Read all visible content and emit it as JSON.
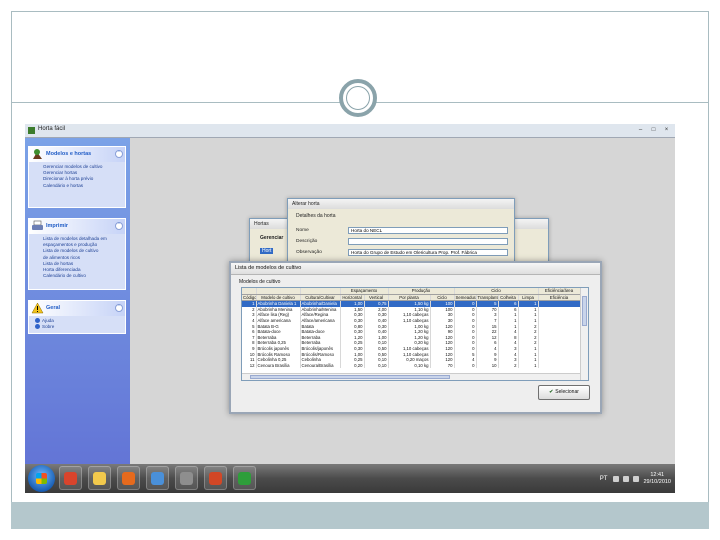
{
  "window": {
    "title": "Horta fácil"
  },
  "taskpane": {
    "groups": [
      {
        "title": "Modelos e hortas",
        "items": [
          "Gerenciar modelos de cultivo",
          "Gerenciar hortas",
          "Direcionar à horta prévio",
          "Calendário e hortas"
        ]
      },
      {
        "title": "Imprimir",
        "items": [
          "Lista de modelos detalhada em",
          "espaçamentos e produção",
          "Lista de modelos de cultivo",
          "de alimentos ricos",
          "Lista de hortas",
          "Horta diferenciada",
          "Calendário de cultivo"
        ]
      },
      {
        "title": "Geral",
        "items": [
          "Ajuda",
          "Sobre"
        ]
      }
    ]
  },
  "back_dialog": {
    "title": "Hortas",
    "tab_label": "Gerenciar",
    "tab2_label": "Hort"
  },
  "edit_dialog": {
    "title": "Alterar horta",
    "tab": "Detalhes da horta",
    "fields": [
      {
        "label": "Nome",
        "value": "Horta do NECL"
      },
      {
        "label": "Descrição",
        "value": ""
      },
      {
        "label": "Observação",
        "value": "Horta do Grupo de Estudo em Olericultura Prop. Prof. Fábrica"
      }
    ]
  },
  "list_window": {
    "title": "Lista de modelos de cultivo",
    "group_label": "Modelos de cultivo",
    "headers": [
      "Código",
      "Modelo de cultivo",
      "Cultura/Cultivar",
      "Horizontal",
      "Vertical",
      "Por planta",
      "Ciclo",
      "Semeadura",
      "Transplante",
      "Colheita",
      "Limpa",
      "Eficiência"
    ],
    "header_groups": {
      "espacamento": "Espaçamento",
      "producao": "Produção",
      "ciclo": "Ciclo",
      "eficiencia": "Eficiência/área"
    },
    "rows": [
      [
        "1",
        "Abobrinha Daniela 1",
        "Abobrinha/Daniela",
        "1,00",
        "0,75",
        "1,50 kg",
        "100",
        "0",
        "5",
        "6",
        "1"
      ],
      [
        "2",
        "Abobrinha Menina",
        "Abobrinha/Menina",
        "1,50",
        "2,00",
        "1,10 kg",
        "100",
        "0",
        "70",
        "6",
        "1"
      ],
      [
        "3",
        "Alface lisa (Reg)",
        "Alface/Regina",
        "0,30",
        "0,30",
        "1,10 cabeças",
        "30",
        "0",
        "3",
        "1",
        "1"
      ],
      [
        "4",
        "Alface americana",
        "Alface/americana",
        "0,30",
        "0,40",
        "1,10 cabeças",
        "30",
        "0",
        "7",
        "1",
        "1"
      ],
      [
        "5",
        "Batata B-G",
        "Batata",
        "0,80",
        "0,30",
        "1,00 kg",
        "120",
        "0",
        "15",
        "1",
        "2"
      ],
      [
        "6",
        "Batata-doce",
        "Batata-doce",
        "0,30",
        "0,40",
        "1,20 kg",
        "90",
        "0",
        "22",
        "4",
        "2"
      ],
      [
        "7",
        "Beterraba",
        "Beterraba",
        "1,20",
        "1,00",
        "1,20 kg",
        "120",
        "0",
        "12",
        "8",
        "2"
      ],
      [
        "8",
        "Beterraba 0,25",
        "Beterraba",
        "0,25",
        "0,10",
        "0,20 kg",
        "120",
        "0",
        "6",
        "4",
        "2"
      ],
      [
        "9",
        "Brócolis japonês",
        "Brócolis/japonês",
        "0,30",
        "0,50",
        "1,10 cabeças",
        "120",
        "0",
        "4",
        "3",
        "1"
      ],
      [
        "10",
        "Brócolis Ramoso",
        "Brócolis/Ramoso",
        "1,00",
        "0,50",
        "1,10 cabeças",
        "120",
        "5",
        "9",
        "4",
        "1"
      ],
      [
        "11",
        "Cebolinha 0,25",
        "Cebolinha",
        "0,25",
        "0,10",
        "0,20 maços",
        "120",
        "4",
        "9",
        "3",
        "1"
      ],
      [
        "12",
        "Cenoura Brasília",
        "Cenoura/Brasília",
        "0,20",
        "0,10",
        "0,10 kg",
        "70",
        "0",
        "10",
        "2",
        "1"
      ]
    ],
    "select_label": "Selecionar"
  },
  "taskbar": {
    "lang": "PT",
    "time": "12:41",
    "date": "29/10/2010",
    "apps": [
      {
        "name": "chrome",
        "color": "#d9442c"
      },
      {
        "name": "folder",
        "color": "#f2c94c"
      },
      {
        "name": "firefox",
        "color": "#e66a1d"
      },
      {
        "name": "media",
        "color": "#4a90d9"
      },
      {
        "name": "tools",
        "color": "#8e8e8e"
      },
      {
        "name": "presentation",
        "color": "#d24726"
      },
      {
        "name": "horta-app",
        "color": "#2e9e3a"
      }
    ]
  }
}
